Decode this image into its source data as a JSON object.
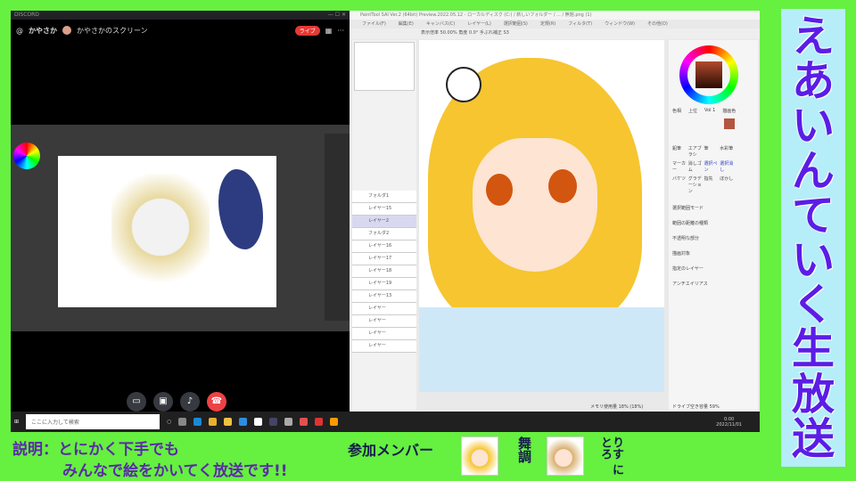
{
  "discord": {
    "window_title": "DISCORD",
    "user": "かやさか",
    "stream_title": "かやさかのスクリーン",
    "live_badge": "ライブ"
  },
  "sai": {
    "window_title": "PaintTool SAI Ver.2 (64bit) Preview.2022.05.12 - ローカルディスク (C:) / 新しいフォルダー / ... / 無題.png (1)",
    "menu": [
      "ファイル(F)",
      "編集(E)",
      "キャンバス(C)",
      "レイヤー(L)",
      "選択範囲(S)",
      "定規(R)",
      "フィルタ(T)",
      "ウィンドウ(W)",
      "その他(O)"
    ],
    "toolbar": "表示倍率 50.00%  角度 0.0°  手ぶれ補正 S3",
    "color_tabs": [
      "色相",
      "上位",
      "Vol 1",
      "描画色"
    ],
    "brush_tools": [
      "鉛筆",
      "エアブラシ",
      "筆",
      "水彩筆",
      "マーカー",
      "消しゴム",
      "選択ペン",
      "選択消し",
      "バケツ",
      "グラデーション",
      "指先",
      "ぼかし"
    ],
    "options": [
      "選択範囲モード",
      "範囲の距離の種類",
      "不透明な部分",
      "描画対象",
      "指定のレイヤー",
      "アンチエイリアス"
    ],
    "layers": [
      "フォルダ1",
      "レイヤー15",
      "レイヤー2",
      "フォルダ2",
      "レイヤー16",
      "レイヤー17",
      "レイヤー18",
      "レイヤー19",
      "レイヤー13",
      "レイヤー",
      "レイヤー",
      "レイヤー",
      "レイヤー"
    ],
    "status": {
      "memory": "メモリ使用量 18% (18%)",
      "drive": "ドライブ空き容量 59%"
    }
  },
  "taskbar": {
    "search_placeholder": "ここに入力して検索",
    "time": "0:00",
    "date": "2022/11/01"
  },
  "overlay": {
    "title_chars": [
      "え",
      "あ",
      "い",
      "ん",
      "て",
      "い",
      "く",
      "生",
      "放",
      "送"
    ],
    "description_line1": "説明：とにかく下手でも",
    "description_line2": "みんなで絵をかいてく放送です!!",
    "members_label": "参加メンバー",
    "members": [
      {
        "name": "舞調"
      },
      {
        "name": "りす にとろ"
      }
    ]
  }
}
